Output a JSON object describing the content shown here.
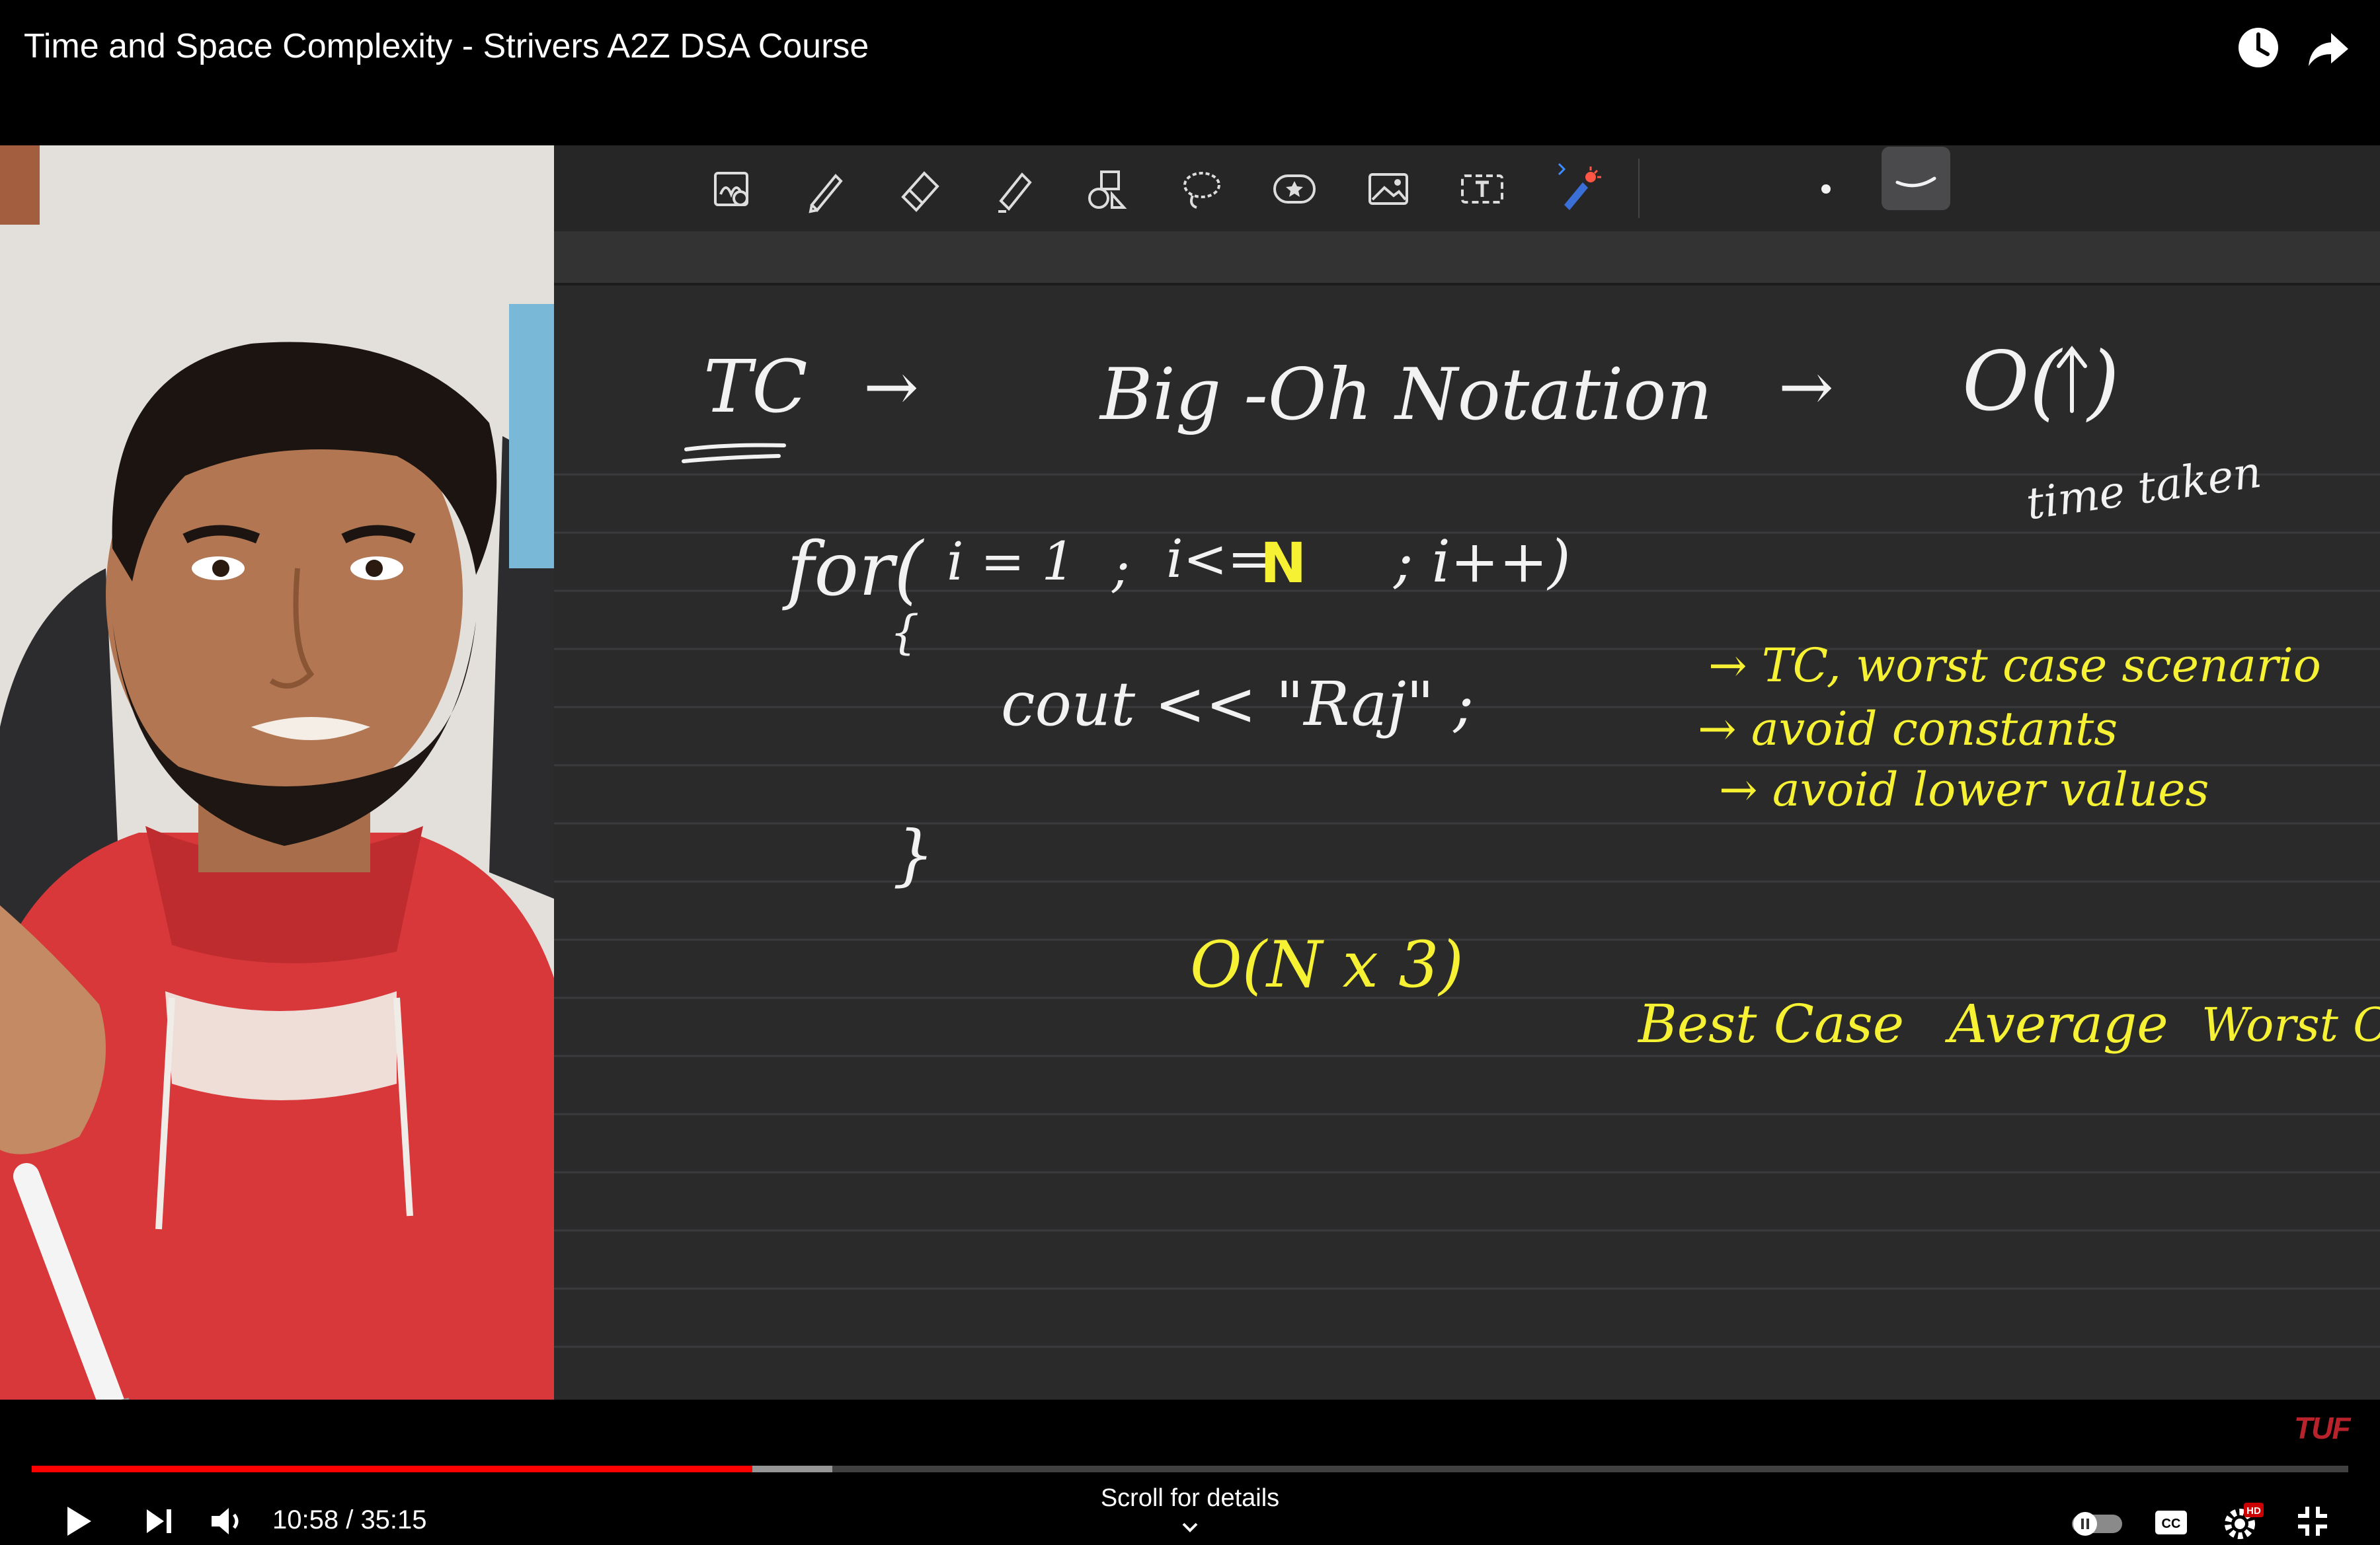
{
  "window": {
    "title": "Time and Space Complexity - Strivers A2Z DSA Course"
  },
  "top_actions": {
    "watch_later_icon": "clock-icon",
    "share_icon": "share-icon"
  },
  "notes": {
    "toolbar_tools": [
      "zoom-select-icon",
      "pen-icon",
      "eraser-icon",
      "highlighter-icon",
      "shapes-icon",
      "lasso-icon",
      "sticker-icon",
      "image-icon",
      "text-box-icon",
      "laser-pointer-icon"
    ],
    "lines": {
      "tc_label": "TC",
      "arrow1": "→",
      "big_oh": "Big -Oh Notation",
      "arrow2": "→",
      "o_paren": "O(  )",
      "up_arrow": "↑",
      "time_taken": "time taken",
      "for_loop_for": "for(",
      "for_loop_init": "i = 1",
      "for_loop_semicolon1": ";",
      "for_loop_cond_i": "i<=",
      "for_loop_cond_n": "N",
      "for_loop_rest": "; i++)",
      "open_brace": "{",
      "cout_line": "cout << \"Raj\" ;",
      "close_brace": "}",
      "bullet1": "→ TC, worst case scenario",
      "bullet2": "→ avoid constants",
      "bullet3": "→ avoid lower values",
      "big_o_expr": "O(N x 3)",
      "cases": [
        "Best Case",
        "Average",
        "Worst Case"
      ]
    },
    "colors": {
      "board_bg": "#2a2a2b",
      "chalk_white": "#f2f2f2",
      "chalk_yellow": "#f6f233"
    }
  },
  "player": {
    "brand": "TUF",
    "current_time": "10:58",
    "separator": " / ",
    "duration": "35:15",
    "time_text": "10:58 / 35:15",
    "progress_played_fraction": 0.3112,
    "progress_buffered_fraction": 0.3455,
    "scroll_hint": "Scroll for details",
    "icons": {
      "play": "play-icon",
      "next": "next-icon",
      "volume": "volume-icon",
      "autoplay": "autoplay-toggle-icon",
      "captions": "captions-icon",
      "settings": "settings-icon",
      "hd_badge": "HD",
      "exit_fullscreen": "exit-fullscreen-icon"
    },
    "colors": {
      "progress": "#ff0000",
      "brand_red": "#b8222b"
    }
  }
}
